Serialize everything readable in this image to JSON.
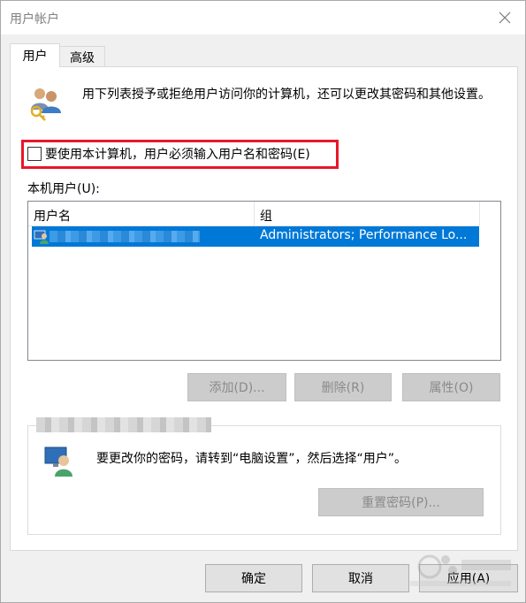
{
  "window": {
    "title": "用户帐户"
  },
  "tabs": [
    {
      "label": "用户",
      "selected": true
    },
    {
      "label": "高级",
      "selected": false
    }
  ],
  "intro": {
    "text": "用下列表授予或拒绝用户访问你的计算机，还可以更改其密码和其他设置。"
  },
  "require_login": {
    "label": "要使用本计算机，用户必须输入用户名和密码(E)",
    "checked": false,
    "highlight_color": "#e8172b"
  },
  "local_users": {
    "label": "本机用户(U):",
    "columns": [
      "用户名",
      "组"
    ],
    "rows": [
      {
        "username": "",
        "group": "Administrators; Performance Lo...",
        "selected": true
      }
    ],
    "selection_color": "#0078d7"
  },
  "user_buttons": {
    "add": "添加(D)...",
    "remove": "删除(R)",
    "properties": "属性(O)"
  },
  "password_section": {
    "text": "要更改你的密码，请转到“电脑设置”，然后选择“用户”。",
    "reset_button": "重置密码(P)..."
  },
  "dialog_buttons": {
    "ok": "确定",
    "cancel": "取消",
    "apply": "应用(A)"
  }
}
